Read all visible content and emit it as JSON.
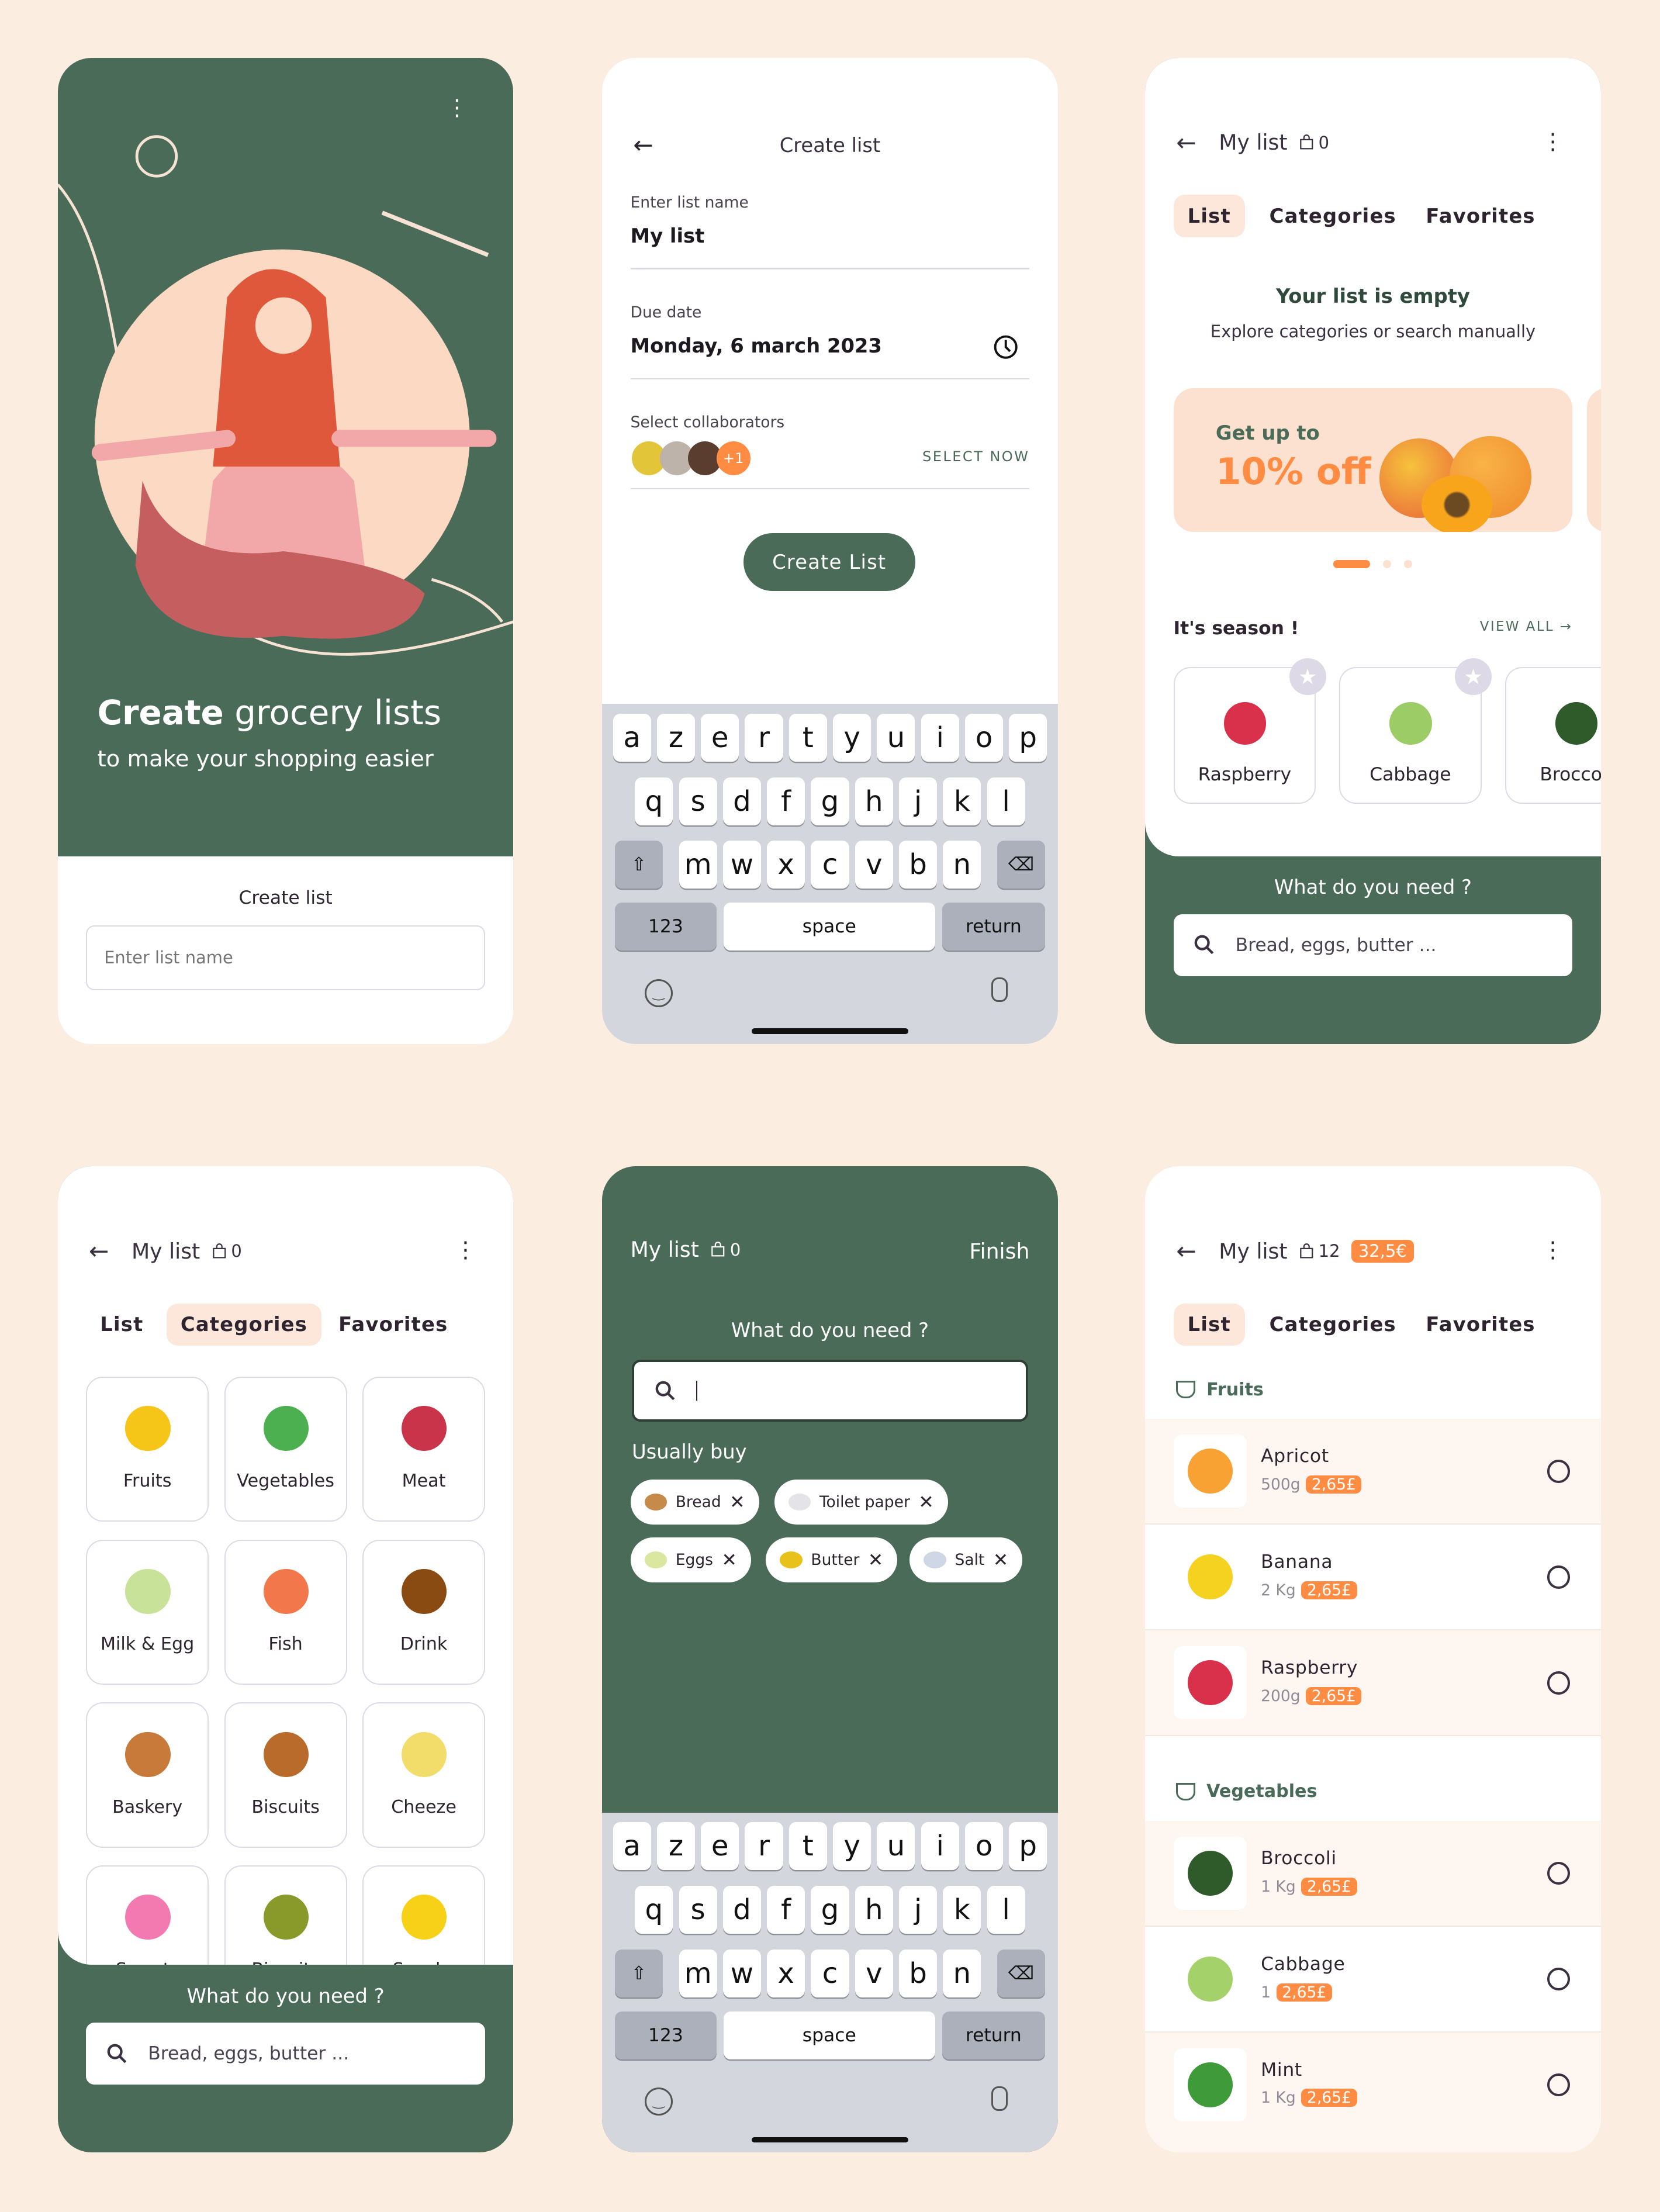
{
  "colors": {
    "background": "#fcede1",
    "green": "#4a6b58",
    "orange": "#ff8c42",
    "peach": "#fde1d0"
  },
  "keyboard": {
    "rows": [
      [
        "a",
        "z",
        "e",
        "r",
        "t",
        "y",
        "u",
        "i",
        "o",
        "p"
      ],
      [
        "q",
        "s",
        "d",
        "f",
        "g",
        "h",
        "j",
        "k",
        "l"
      ],
      [
        "m",
        "w",
        "x",
        "c",
        "v",
        "b",
        "n"
      ]
    ],
    "numbers": "123",
    "space": "space",
    "return": "return"
  },
  "onboarding": {
    "title_bold": "Create",
    "title_rest": "grocery lists",
    "subtitle": "to make your shopping easier",
    "form_label": "Create list",
    "input_placeholder": "Enter list name"
  },
  "create": {
    "title": "Create list",
    "name_label": "Enter list name",
    "name_value": "My list",
    "date_label": "Due date",
    "date_value": "Monday, 6 march 2023",
    "collab_label": "Select collaborators",
    "collab_extra": "+1",
    "select_now": "SELECT NOW",
    "button": "Create List"
  },
  "empty_list": {
    "title": "My list",
    "count": "0",
    "tabs": [
      "List",
      "Categories",
      "Favorites"
    ],
    "empty_title": "Your list is empty",
    "empty_sub": "Explore categories or search manually",
    "promo_line1": "Get up to",
    "promo_line2": "10% off",
    "carousel": {
      "active": 0,
      "count": 3
    },
    "season_title": "It's season !",
    "view_all": "VIEW ALL",
    "season_items": [
      {
        "name": "Raspberry",
        "color": "#d9304c"
      },
      {
        "name": "Cabbage",
        "color": "#9ccc65"
      },
      {
        "name": "Broccoli",
        "color": "#2f5a2a"
      }
    ],
    "search_title": "What do you need ?",
    "search_placeholder": "Bread, eggs, butter ..."
  },
  "categories": {
    "title": "My list",
    "count": "0",
    "tabs": [
      "List",
      "Categories",
      "Favorites"
    ],
    "items": [
      {
        "name": "Fruits",
        "color": "#f5c518"
      },
      {
        "name": "Vegetables",
        "color": "#4caf50"
      },
      {
        "name": "Meat",
        "color": "#c9344a"
      },
      {
        "name": "Milk & Egg",
        "color": "#c8e29a"
      },
      {
        "name": "Fish",
        "color": "#f2784b"
      },
      {
        "name": "Drink",
        "color": "#8a4b12"
      },
      {
        "name": "Baskery",
        "color": "#c77a3a"
      },
      {
        "name": "Biscuits",
        "color": "#b86b2a"
      },
      {
        "name": "Cheeze",
        "color": "#f3dd6a"
      },
      {
        "name": "Sweets",
        "color": "#f27ab0"
      },
      {
        "name": "Biscuits",
        "color": "#8a9a2a"
      },
      {
        "name": "Snacks",
        "color": "#f7d117"
      }
    ],
    "search_title": "What do you need ?",
    "search_placeholder": "Bread, eggs, butter ..."
  },
  "search": {
    "title": "My list",
    "count": "0",
    "finish": "Finish",
    "prompt": "What do you need ?",
    "input_value": "",
    "usually_buy": "Usually buy",
    "chips": [
      {
        "name": "Bread",
        "color": "#c68a4a"
      },
      {
        "name": "Toilet paper",
        "color": "#e4e4e8"
      },
      {
        "name": "Eggs",
        "color": "#d9e7a0"
      },
      {
        "name": "Butter",
        "color": "#e8c21a"
      },
      {
        "name": "Salt",
        "color": "#cfd6e6"
      }
    ]
  },
  "filled_list": {
    "title": "My list",
    "count": "12",
    "total": "32,5€",
    "tabs": [
      "List",
      "Categories",
      "Favorites"
    ],
    "sections": [
      {
        "name": "Fruits",
        "items": [
          {
            "name": "Apricot",
            "qty": "500g",
            "price": "2,65£",
            "color": "#f7a233"
          },
          {
            "name": "Banana",
            "qty": "2 Kg",
            "price": "2,65£",
            "color": "#f4d21f"
          },
          {
            "name": "Raspberry",
            "qty": "200g",
            "price": "2,65£",
            "color": "#d9304c"
          }
        ]
      },
      {
        "name": "Vegetables",
        "items": [
          {
            "name": "Broccoli",
            "qty": "1 Kg",
            "price": "2,65£",
            "color": "#2f5a2a"
          },
          {
            "name": "Cabbage",
            "qty": "1",
            "price": "2,65£",
            "color": "#a5d16b"
          },
          {
            "name": "Mint",
            "qty": "1 Kg",
            "price": "2,65£",
            "color": "#3f9a3a"
          }
        ]
      }
    ]
  }
}
